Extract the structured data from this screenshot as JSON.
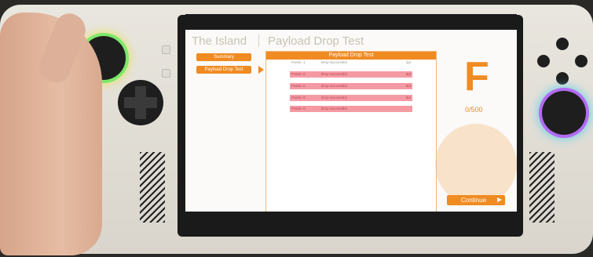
{
  "game": {
    "left_title": "The Island",
    "right_title": "Payload Drop Test",
    "nav": [
      {
        "label": "Summary"
      },
      {
        "label": "Payload Drop Test"
      }
    ],
    "panel_title": "Payload Drop Test",
    "rows": [
      {
        "points": "Points: 1",
        "message": "Drop Successful",
        "value": "1pt",
        "style": "plain"
      },
      {
        "points": "Points: 0",
        "message": "Drop Successful",
        "value": "0pt",
        "style": "red"
      },
      {
        "points": "Points: 0",
        "message": "Drop Successful",
        "value": "0pt",
        "style": "red"
      },
      {
        "points": "Points: 0",
        "message": "Drop Successful",
        "value": "0pt",
        "style": "red"
      },
      {
        "points": "Points: 0",
        "message": "Drop Successful",
        "value": "",
        "style": "red"
      }
    ],
    "grade": "F",
    "score": "0/500",
    "continue_label": "Continue"
  },
  "colors": {
    "accent": "#f08b22",
    "error_row": "#f59aa3",
    "left_ring": "#7de86b",
    "right_ring": "#b26bf2"
  },
  "icons": {
    "continue": "play-triangle-icon",
    "nav_pointer": "triangle-pointer-icon",
    "watermark": "emblem-icon"
  }
}
